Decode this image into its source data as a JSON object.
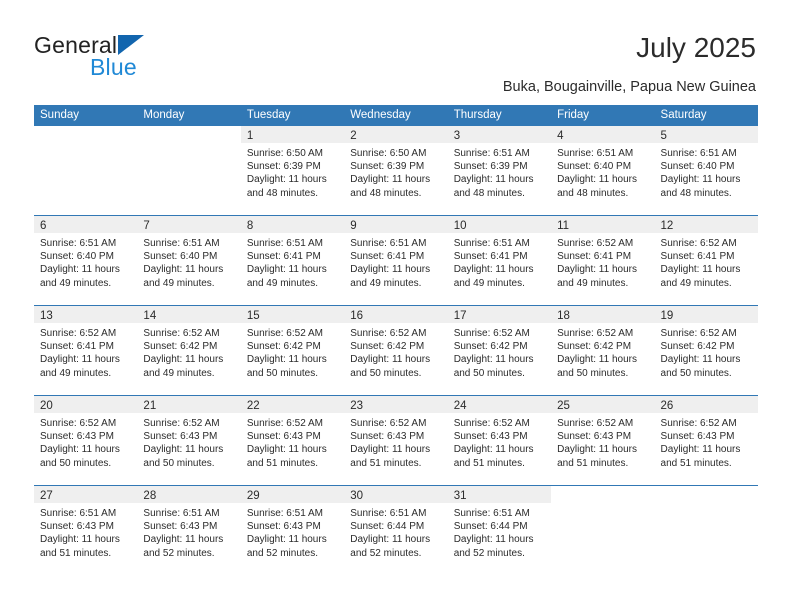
{
  "brand": {
    "name_top": "General",
    "name_bottom": "Blue",
    "accent_color": "#2089d6",
    "triangle_color": "#1265ae"
  },
  "header": {
    "title": "July 2025",
    "subtitle": "Buka, Bougainville, Papua New Guinea"
  },
  "calendar": {
    "header_bg": "#3178b5",
    "header_text_color": "#ffffff",
    "day_band_bg": "#efefef",
    "weekdays": [
      "Sunday",
      "Monday",
      "Tuesday",
      "Wednesday",
      "Thursday",
      "Friday",
      "Saturday"
    ],
    "weeks": [
      [
        {
          "day": "",
          "sunrise": "",
          "sunset": "",
          "daylight": "",
          "blank": true
        },
        {
          "day": "",
          "sunrise": "",
          "sunset": "",
          "daylight": "",
          "blank": true
        },
        {
          "day": "1",
          "sunrise": "Sunrise: 6:50 AM",
          "sunset": "Sunset: 6:39 PM",
          "daylight": "Daylight: 11 hours and 48 minutes."
        },
        {
          "day": "2",
          "sunrise": "Sunrise: 6:50 AM",
          "sunset": "Sunset: 6:39 PM",
          "daylight": "Daylight: 11 hours and 48 minutes."
        },
        {
          "day": "3",
          "sunrise": "Sunrise: 6:51 AM",
          "sunset": "Sunset: 6:39 PM",
          "daylight": "Daylight: 11 hours and 48 minutes."
        },
        {
          "day": "4",
          "sunrise": "Sunrise: 6:51 AM",
          "sunset": "Sunset: 6:40 PM",
          "daylight": "Daylight: 11 hours and 48 minutes."
        },
        {
          "day": "5",
          "sunrise": "Sunrise: 6:51 AM",
          "sunset": "Sunset: 6:40 PM",
          "daylight": "Daylight: 11 hours and 48 minutes."
        }
      ],
      [
        {
          "day": "6",
          "sunrise": "Sunrise: 6:51 AM",
          "sunset": "Sunset: 6:40 PM",
          "daylight": "Daylight: 11 hours and 49 minutes."
        },
        {
          "day": "7",
          "sunrise": "Sunrise: 6:51 AM",
          "sunset": "Sunset: 6:40 PM",
          "daylight": "Daylight: 11 hours and 49 minutes."
        },
        {
          "day": "8",
          "sunrise": "Sunrise: 6:51 AM",
          "sunset": "Sunset: 6:41 PM",
          "daylight": "Daylight: 11 hours and 49 minutes."
        },
        {
          "day": "9",
          "sunrise": "Sunrise: 6:51 AM",
          "sunset": "Sunset: 6:41 PM",
          "daylight": "Daylight: 11 hours and 49 minutes."
        },
        {
          "day": "10",
          "sunrise": "Sunrise: 6:51 AM",
          "sunset": "Sunset: 6:41 PM",
          "daylight": "Daylight: 11 hours and 49 minutes."
        },
        {
          "day": "11",
          "sunrise": "Sunrise: 6:52 AM",
          "sunset": "Sunset: 6:41 PM",
          "daylight": "Daylight: 11 hours and 49 minutes."
        },
        {
          "day": "12",
          "sunrise": "Sunrise: 6:52 AM",
          "sunset": "Sunset: 6:41 PM",
          "daylight": "Daylight: 11 hours and 49 minutes."
        }
      ],
      [
        {
          "day": "13",
          "sunrise": "Sunrise: 6:52 AM",
          "sunset": "Sunset: 6:41 PM",
          "daylight": "Daylight: 11 hours and 49 minutes."
        },
        {
          "day": "14",
          "sunrise": "Sunrise: 6:52 AM",
          "sunset": "Sunset: 6:42 PM",
          "daylight": "Daylight: 11 hours and 49 minutes."
        },
        {
          "day": "15",
          "sunrise": "Sunrise: 6:52 AM",
          "sunset": "Sunset: 6:42 PM",
          "daylight": "Daylight: 11 hours and 50 minutes."
        },
        {
          "day": "16",
          "sunrise": "Sunrise: 6:52 AM",
          "sunset": "Sunset: 6:42 PM",
          "daylight": "Daylight: 11 hours and 50 minutes."
        },
        {
          "day": "17",
          "sunrise": "Sunrise: 6:52 AM",
          "sunset": "Sunset: 6:42 PM",
          "daylight": "Daylight: 11 hours and 50 minutes."
        },
        {
          "day": "18",
          "sunrise": "Sunrise: 6:52 AM",
          "sunset": "Sunset: 6:42 PM",
          "daylight": "Daylight: 11 hours and 50 minutes."
        },
        {
          "day": "19",
          "sunrise": "Sunrise: 6:52 AM",
          "sunset": "Sunset: 6:42 PM",
          "daylight": "Daylight: 11 hours and 50 minutes."
        }
      ],
      [
        {
          "day": "20",
          "sunrise": "Sunrise: 6:52 AM",
          "sunset": "Sunset: 6:43 PM",
          "daylight": "Daylight: 11 hours and 50 minutes."
        },
        {
          "day": "21",
          "sunrise": "Sunrise: 6:52 AM",
          "sunset": "Sunset: 6:43 PM",
          "daylight": "Daylight: 11 hours and 50 minutes."
        },
        {
          "day": "22",
          "sunrise": "Sunrise: 6:52 AM",
          "sunset": "Sunset: 6:43 PM",
          "daylight": "Daylight: 11 hours and 51 minutes."
        },
        {
          "day": "23",
          "sunrise": "Sunrise: 6:52 AM",
          "sunset": "Sunset: 6:43 PM",
          "daylight": "Daylight: 11 hours and 51 minutes."
        },
        {
          "day": "24",
          "sunrise": "Sunrise: 6:52 AM",
          "sunset": "Sunset: 6:43 PM",
          "daylight": "Daylight: 11 hours and 51 minutes."
        },
        {
          "day": "25",
          "sunrise": "Sunrise: 6:52 AM",
          "sunset": "Sunset: 6:43 PM",
          "daylight": "Daylight: 11 hours and 51 minutes."
        },
        {
          "day": "26",
          "sunrise": "Sunrise: 6:52 AM",
          "sunset": "Sunset: 6:43 PM",
          "daylight": "Daylight: 11 hours and 51 minutes."
        }
      ],
      [
        {
          "day": "27",
          "sunrise": "Sunrise: 6:51 AM",
          "sunset": "Sunset: 6:43 PM",
          "daylight": "Daylight: 11 hours and 51 minutes."
        },
        {
          "day": "28",
          "sunrise": "Sunrise: 6:51 AM",
          "sunset": "Sunset: 6:43 PM",
          "daylight": "Daylight: 11 hours and 52 minutes."
        },
        {
          "day": "29",
          "sunrise": "Sunrise: 6:51 AM",
          "sunset": "Sunset: 6:43 PM",
          "daylight": "Daylight: 11 hours and 52 minutes."
        },
        {
          "day": "30",
          "sunrise": "Sunrise: 6:51 AM",
          "sunset": "Sunset: 6:44 PM",
          "daylight": "Daylight: 11 hours and 52 minutes."
        },
        {
          "day": "31",
          "sunrise": "Sunrise: 6:51 AM",
          "sunset": "Sunset: 6:44 PM",
          "daylight": "Daylight: 11 hours and 52 minutes."
        },
        {
          "day": "",
          "sunrise": "",
          "sunset": "",
          "daylight": "",
          "blank": true
        },
        {
          "day": "",
          "sunrise": "",
          "sunset": "",
          "daylight": "",
          "blank": true
        }
      ]
    ]
  }
}
